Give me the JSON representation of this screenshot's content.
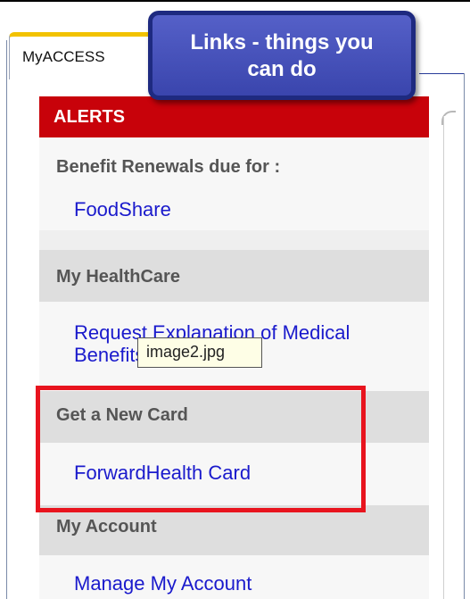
{
  "tab": {
    "label": "MyACCESS"
  },
  "callout": {
    "line1": "Links - things you",
    "line2": "can do"
  },
  "alerts": {
    "header": "ALERTS",
    "renewal_text": "Benefit Renewals due for :",
    "renewal_link": "FoodShare"
  },
  "healthcare": {
    "header": "My HealthCare",
    "link_line1": "Request Explanation of Medical",
    "link_line2": "Benefits (EOMB)"
  },
  "tooltip": {
    "text": "image2.jpg"
  },
  "new_card": {
    "header": "Get a New Card",
    "link": "ForwardHealth Card"
  },
  "account": {
    "header": "My Account",
    "link": "Manage My Account"
  },
  "colors": {
    "alerts_red": "#c8020a",
    "link_blue": "#1a1acc",
    "callout_blue": "#3a45ad",
    "highlight_red": "#e8141e",
    "tab_accent": "#f2c200"
  }
}
